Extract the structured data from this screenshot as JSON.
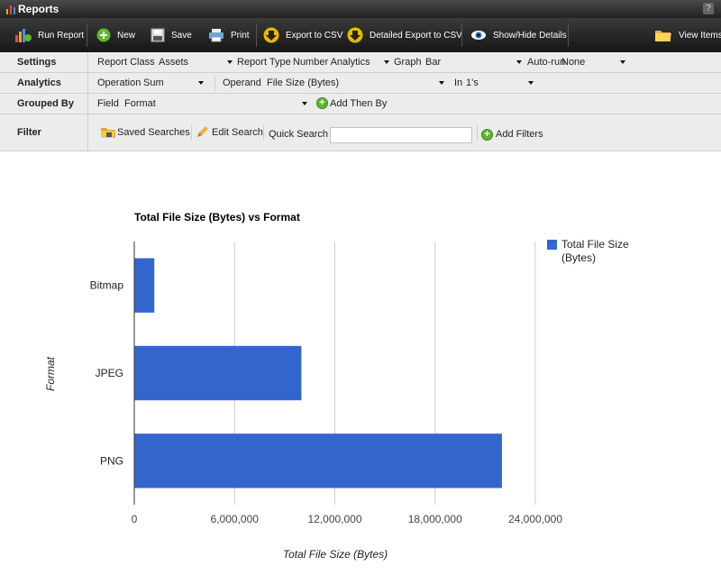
{
  "window": {
    "title": "Reports",
    "help_label": "?"
  },
  "toolbar": {
    "run_report": "Run Report",
    "new": "New",
    "save": "Save",
    "print": "Print",
    "export_csv": "Export to CSV",
    "detailed_export": "Detailed Export to CSV",
    "show_hide": "Show/Hide Details",
    "view_items": "View Items"
  },
  "settings": {
    "label": "Settings",
    "report_class_label": "Report Class",
    "report_class_value": "Assets",
    "report_type_label": "Report Type",
    "report_type_value": "Number Analytics",
    "graph_label": "Graph",
    "graph_value": "Bar",
    "autorun_label": "Auto-run",
    "autorun_value": "None"
  },
  "analytics": {
    "label": "Analytics",
    "operation_label": "Operation",
    "operation_value": "Sum",
    "operand_label": "Operand",
    "operand_value": "File Size (Bytes)",
    "in_label": "In",
    "in_value": "1's"
  },
  "grouped_by": {
    "label": "Grouped By",
    "field_label": "Field",
    "field_value": "Format",
    "add_then_by": "Add Then By"
  },
  "filter": {
    "label": "Filter",
    "saved_searches": "Saved Searches",
    "edit_search": "Edit Search",
    "quick_search_label": "Quick Search",
    "quick_search_value": "",
    "add_filters": "Add Filters"
  },
  "chart_data": {
    "type": "bar",
    "orientation": "horizontal",
    "title": "Total File Size (Bytes) vs Format",
    "xlabel": "Total File Size (Bytes)",
    "ylabel": "Format",
    "categories": [
      "Bitmap",
      "JPEG",
      "PNG"
    ],
    "series": [
      {
        "name": "Total File Size (Bytes)",
        "values": [
          1200000,
          10000000,
          22000000
        ],
        "color": "#3366cc"
      }
    ],
    "x_ticks": [
      "0",
      "6,000,000",
      "12,000,000",
      "18,000,000",
      "24,000,000"
    ],
    "xlim": [
      0,
      24000000
    ],
    "grid": true,
    "legend_position": "right"
  }
}
